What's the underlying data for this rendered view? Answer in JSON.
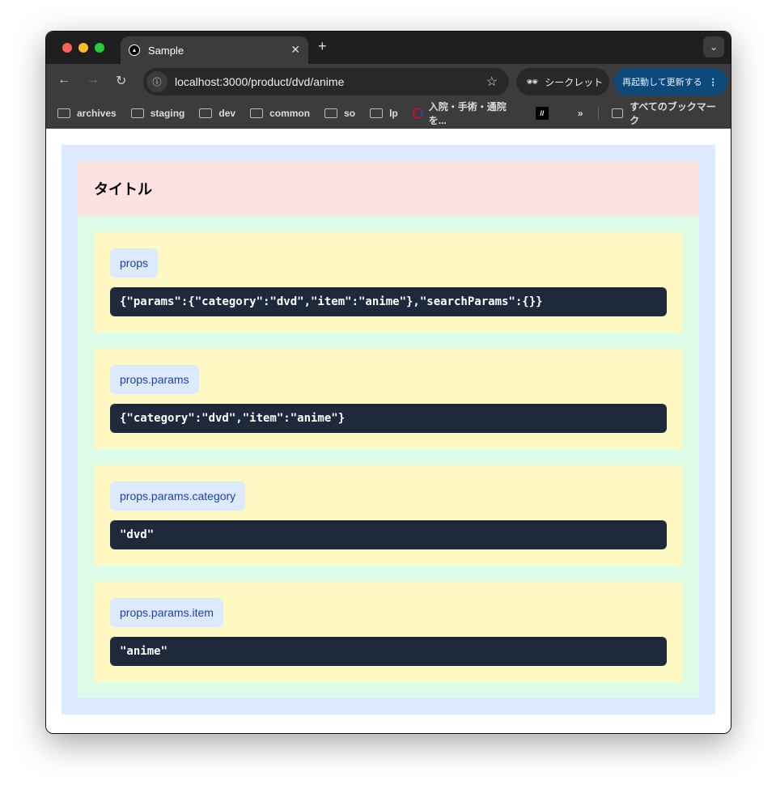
{
  "browser": {
    "tab_title": "Sample",
    "url": "localhost:3000/product/dvd/anime",
    "incognito_label": "シークレット",
    "update_label": "再起動して更新する",
    "bookmarks": [
      "archives",
      "staging",
      "dev",
      "common",
      "so",
      "lp"
    ],
    "bookmark_site": "入院・手術・通院を...",
    "all_bookmarks": "すべてのブックマーク",
    "more": "»"
  },
  "page": {
    "title": "タイトル",
    "cards": [
      {
        "label": "props",
        "value": "{\"params\":{\"category\":\"dvd\",\"item\":\"anime\"},\"searchParams\":{}}"
      },
      {
        "label": "props.params",
        "value": "{\"category\":\"dvd\",\"item\":\"anime\"}"
      },
      {
        "label": "props.params.category",
        "value": "\"dvd\""
      },
      {
        "label": "props.params.item",
        "value": "\"anime\""
      }
    ]
  },
  "colors": {
    "outer": "#dbeafe",
    "header": "#fee2e2",
    "main": "#dcfce7",
    "card": "#fef9c3",
    "code": "#1e293b",
    "label_text": "#1e40af"
  }
}
